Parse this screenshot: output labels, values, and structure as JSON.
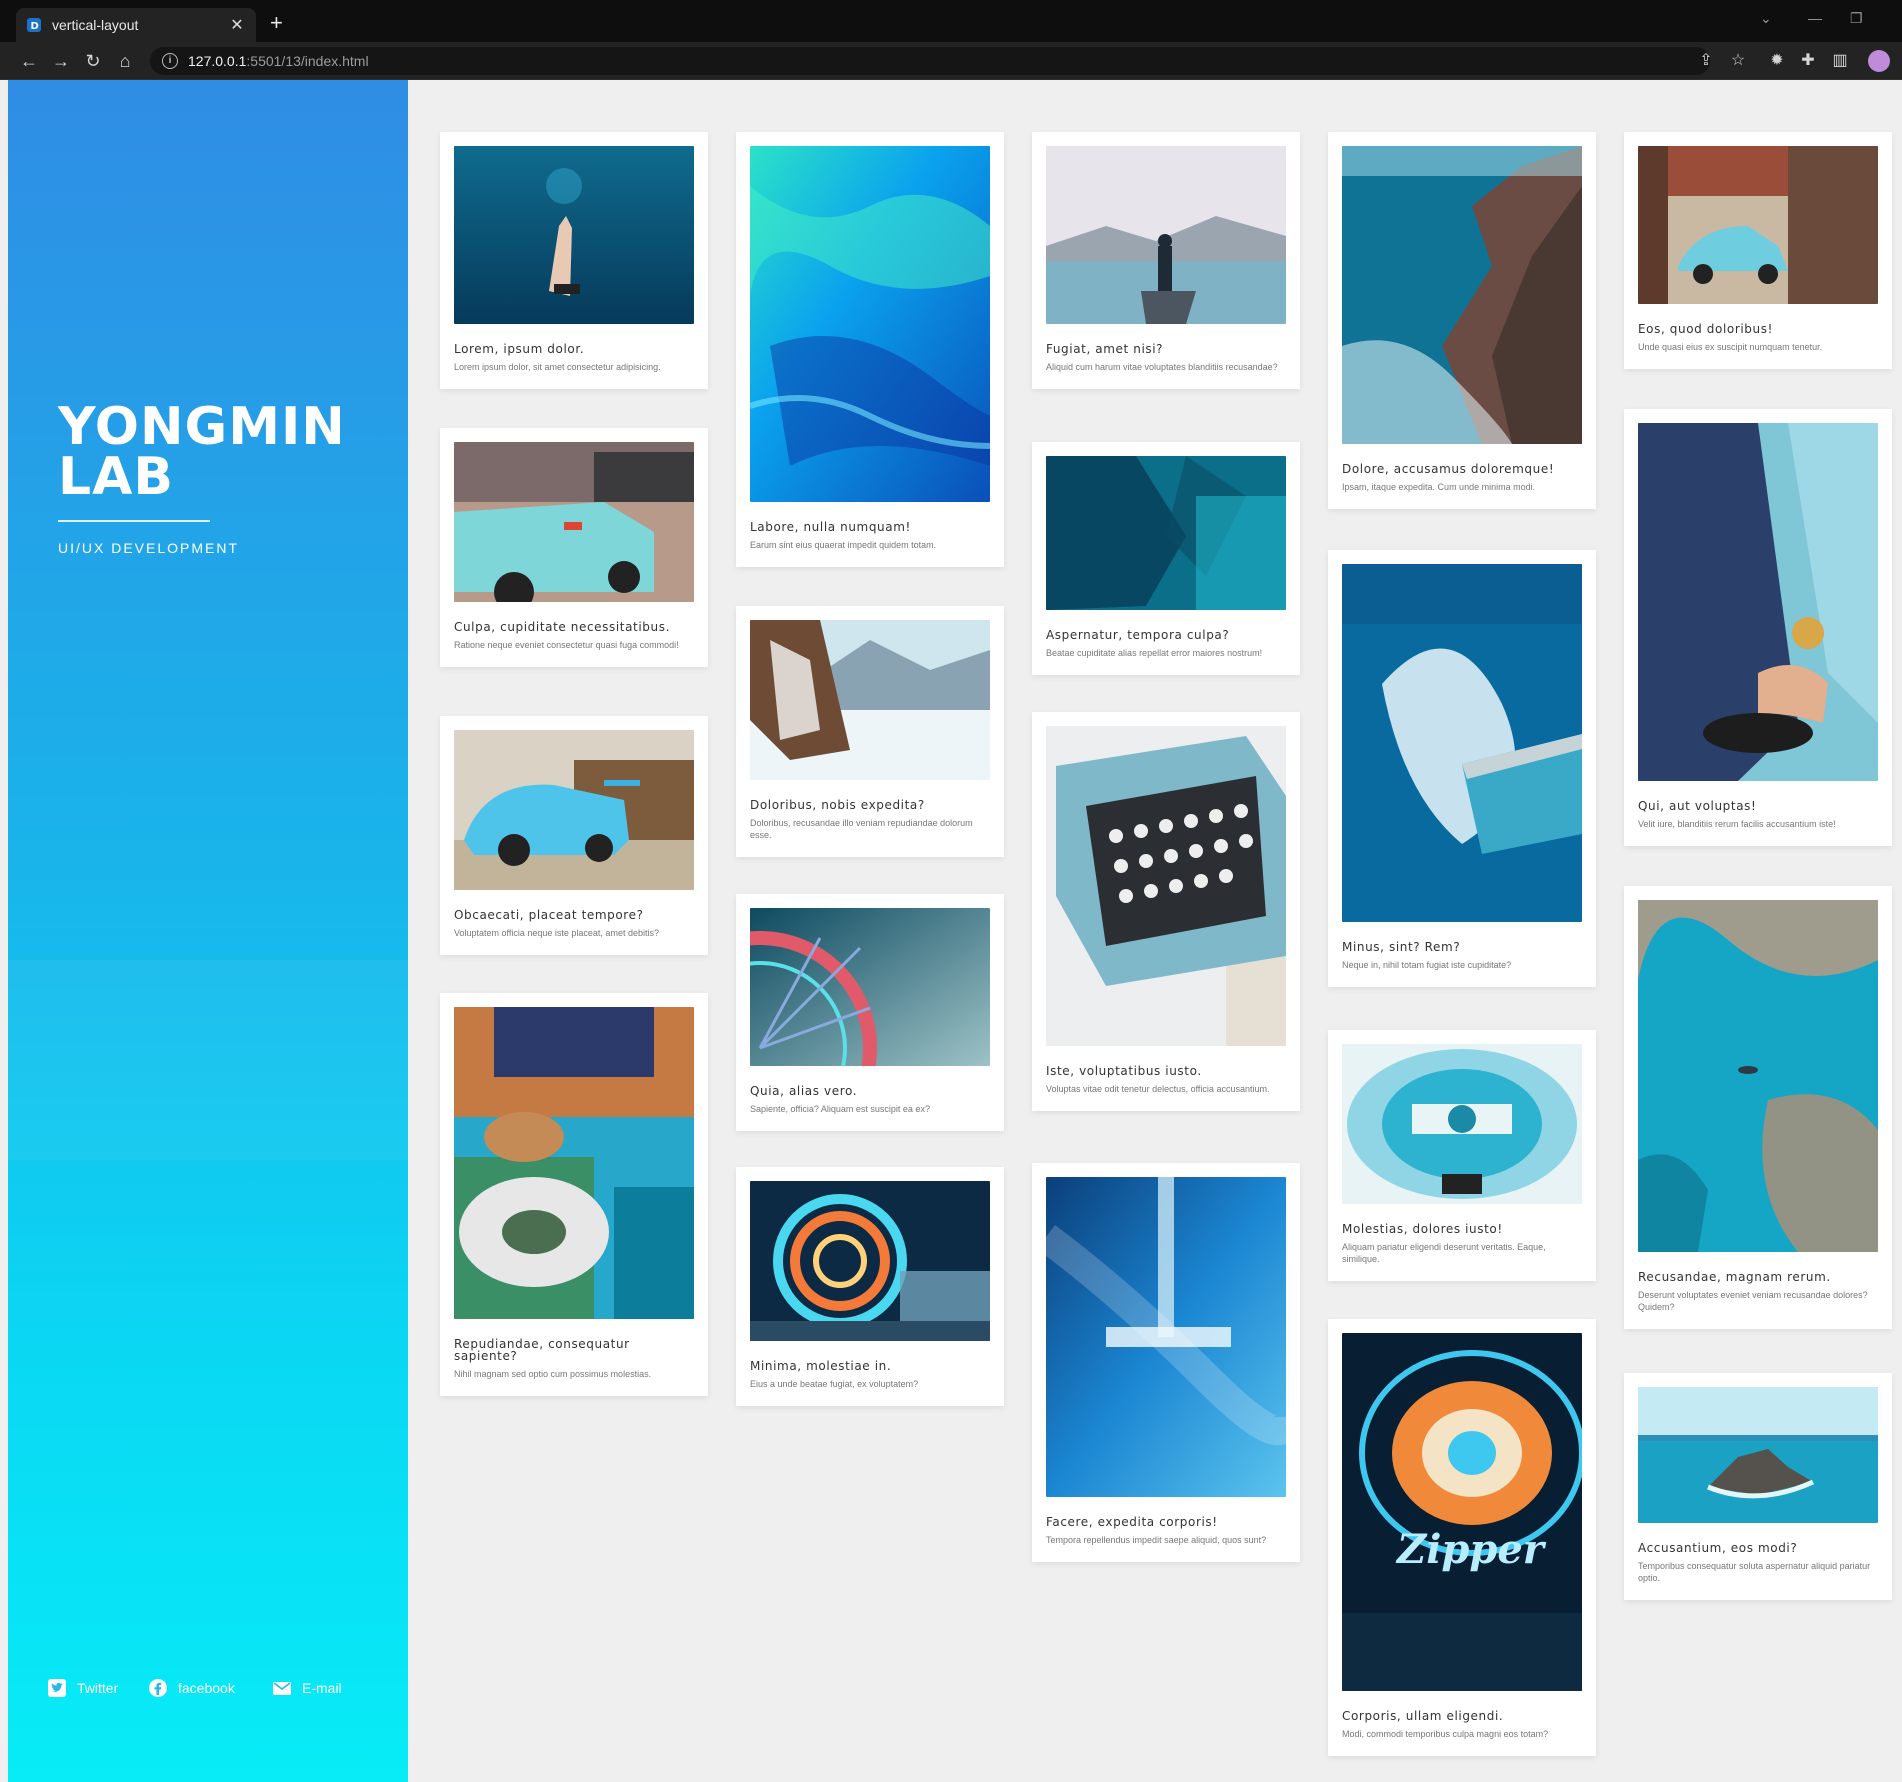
{
  "browser": {
    "tab_title": "vertical-layout",
    "url_host": "127.0.0.1",
    "url_path": ":5501/13/index.html"
  },
  "sidebar": {
    "logo_line1": "YONGMIN",
    "logo_line2": "LAB",
    "tagline": "UI/UX DEVELOPMENT",
    "social": [
      {
        "label": "Twitter",
        "icon": "twitter-icon"
      },
      {
        "label": "facebook",
        "icon": "facebook-icon"
      },
      {
        "label": "E-mail",
        "icon": "mail-icon"
      }
    ]
  },
  "colors": {
    "accent_top": "#2f8de4",
    "accent_bottom": "#07ecf7",
    "background": "#efefef"
  },
  "cards": [
    {
      "title": "Lorem, ipsum dolor.",
      "desc": "Lorem ipsum dolor, sit amet consectetur adipisicing.",
      "image": "underwater hand"
    },
    {
      "title": "Culpa, cupiditate necessitatibus.",
      "desc": "Ratione neque eveniet consectetur quasi fuga commodi!",
      "image": "vintage car"
    },
    {
      "title": "Obcaecati, placeat tempore?",
      "desc": "Voluptatem officia neque iste placeat, amet debitis?",
      "image": "sports car"
    },
    {
      "title": "Repudiandae, consequatur sapiente?",
      "desc": "Nihil magnam sed optio cum possimus molestias.",
      "image": "table setting"
    },
    {
      "title": "Labore, nulla numquam!",
      "desc": "Earum sint eius quaerat impedit quidem totam.",
      "image": "blue paint"
    },
    {
      "title": "Doloribus, nobis expedita?",
      "desc": "Doloribus, recusandae illo veniam repudiandae dolorum esse.",
      "image": "snowy mountain"
    },
    {
      "title": "Quia, alias vero.",
      "desc": "Sapiente, officia? Aliquam est suscipit ea ex?",
      "image": "ferris wheel"
    },
    {
      "title": "Minima, molestiae in.",
      "desc": "Eius a unde beatae fugiat, ex voluptatem?",
      "image": "ferris wheel night"
    },
    {
      "title": "Fugiat, amet nisi?",
      "desc": "Aliquid cum harum vitae voluptates blanditiis recusandae?",
      "image": "lake person"
    },
    {
      "title": "Aspernatur, tempora culpa?",
      "desc": "Beatae cupiditate alias repellat error maiores nostrum!",
      "image": "brick wall shadow"
    },
    {
      "title": "Iste, voluptatibus iusto.",
      "desc": "Voluptas vitae odit tenetur delectus, officia accusantium.",
      "image": "typewriter"
    },
    {
      "title": "Facere, expedita corporis!",
      "desc": "Tempora repellendus impedit saepe aliquid, quos sunt?",
      "image": "blue abstract"
    },
    {
      "title": "Dolore, accusamus doloremque!",
      "desc": "Ipsam, itaque expedita. Cum unde minima modi.",
      "image": "sea cliffs"
    },
    {
      "title": "Minus, sint? Rem?",
      "desc": "Neque in, nihil totam fugiat iste cupiditate?",
      "image": "waves pier"
    },
    {
      "title": "Molestias, dolores iusto!",
      "desc": "Aliquam pariatur eligendi deserunt veritatis. Eaque, similique.",
      "image": "machine"
    },
    {
      "title": "Corporis, ullam eligendi.",
      "desc": "Modi, commodi temporibus culpa magni eos totam?",
      "image": "carnival ride"
    },
    {
      "title": "Eos, quod doloribus!",
      "desc": "Unde quasi eius ex suscipit numquam tenetur.",
      "image": "beetle car"
    },
    {
      "title": "Qui, aut voluptas!",
      "desc": "Velit iure, blanditiis rerum facilis accusantium iste!",
      "image": "man shoes"
    },
    {
      "title": "Recusandae, magnam rerum.",
      "desc": "Deserunt voluptates eveniet veniam recusandae dolores? Quidem?",
      "image": "ocean aerial"
    },
    {
      "title": "Accusantium, eos modi?",
      "desc": "Temporibus consequatur soluta aspernatur aliquid pariatur optio.",
      "image": "island"
    }
  ]
}
